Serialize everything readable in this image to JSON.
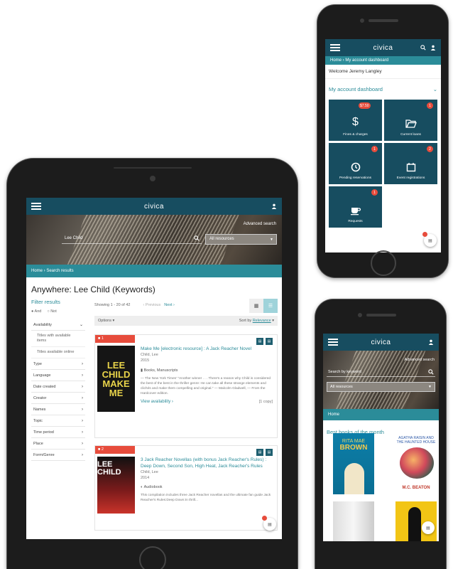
{
  "brand": "civica",
  "tablet": {
    "search": {
      "advanced_label": "Advanced search",
      "query": "Lee Child",
      "scope": "All resources"
    },
    "breadcrumb": "Home  ›  Search results",
    "page_title": "Anywhere: Lee Child (Keywords)",
    "filters": {
      "title": "Filter results",
      "and_label": "And",
      "not_label": "Not",
      "availability": "Availability",
      "availability_options": [
        "Titles with available items",
        "Titles available online"
      ],
      "facets": [
        "Type",
        "Language",
        "Date created",
        "Creator",
        "Names",
        "Topic",
        "Time period",
        "Place",
        "Form/Genre"
      ]
    },
    "results": {
      "showing": "Showing 1 - 20 of 42",
      "previous": "‹  Previous",
      "next": "Next  ›",
      "options": "Options ▾",
      "sort_prefix": "Sort by",
      "sort_value": "Relevance",
      "items": [
        {
          "number": "1",
          "cover_lines": [
            "LEE",
            "CHILD",
            "MAKE",
            "ME"
          ],
          "title": "Make Me [electronic resource] : A Jack Reacher Novel",
          "author": "Child, Lee",
          "year": "2015",
          "format": "Books, Manuscripts",
          "description": "— The New York Times' \"Another winner . . . There's a reason why Child is considered the best of the best in the thriller genre: He can take all these strange elements and clichés and make them compelling and original.\" — Malcolm Gladwell, — From the Hardcover edition.",
          "availability": "View availability ›",
          "copies": "[1 copy]"
        },
        {
          "number": "2",
          "cover_lines": [
            "LEE CHILD"
          ],
          "title": "3 Jack Reacher Novellas (with bonus Jack Reacher's Rules) : Deep Down, Second Son, High Heat, Jack Reacher's Rules",
          "author": "Child, Lee",
          "year": "2014",
          "format": "Audiobook",
          "description": "This compilation includes three Jack Reacher novellas and the ultimate fan guide Jack Reacher's Rules:Deep Down:In thrill..."
        }
      ]
    }
  },
  "phone1": {
    "breadcrumb": "Home  ›  My account dashboard",
    "welcome": "Welcome Jeremy Langley",
    "dashboard_title": "My account dashboard",
    "tiles": [
      {
        "label": "Fines & charges",
        "badge": "$7.50",
        "icon": "dollar-icon"
      },
      {
        "label": "Current loans",
        "badge": "1",
        "icon": "folder-open-icon"
      },
      {
        "label": "Pending reservations",
        "badge": "1",
        "icon": "clock-icon"
      },
      {
        "label": "Event registrations",
        "badge": "2",
        "icon": "calendar-icon"
      },
      {
        "label": "Requests",
        "badge": "1",
        "icon": "coffee-cup-icon"
      }
    ]
  },
  "phone2": {
    "advanced_label": "Advanced search",
    "search_placeholder": "Search by keyword",
    "scope": "All resources",
    "breadcrumb": "Home",
    "section_title": "Best books of the month",
    "books": [
      {
        "title": "RITA MAE",
        "author": "BROWN"
      },
      {
        "title": "AGATHA RAISIN AND THE HAUNTED HOUSE",
        "author": "M.C. BEATON"
      }
    ]
  },
  "colors": {
    "primary": "#174d60",
    "accent": "#2b8c99",
    "badge": "#e74c3c"
  }
}
